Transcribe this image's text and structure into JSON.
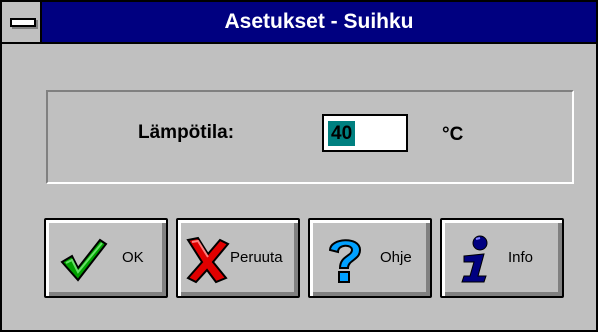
{
  "window": {
    "title": "Asetukset - Suihku"
  },
  "settings": {
    "temperature_label": "Lämpötila:",
    "temperature_value": "40",
    "unit": "°C"
  },
  "buttons": {
    "ok": {
      "label": "OK",
      "icon": "checkmark-icon",
      "color": "#00a000"
    },
    "cancel": {
      "label": "Peruuta",
      "icon": "x-icon",
      "color": "#e00000"
    },
    "help": {
      "label": "Ohje",
      "icon": "question-icon",
      "color": "#00a0ff"
    },
    "info": {
      "label": "Info",
      "icon": "info-icon",
      "color": "#000080"
    }
  }
}
